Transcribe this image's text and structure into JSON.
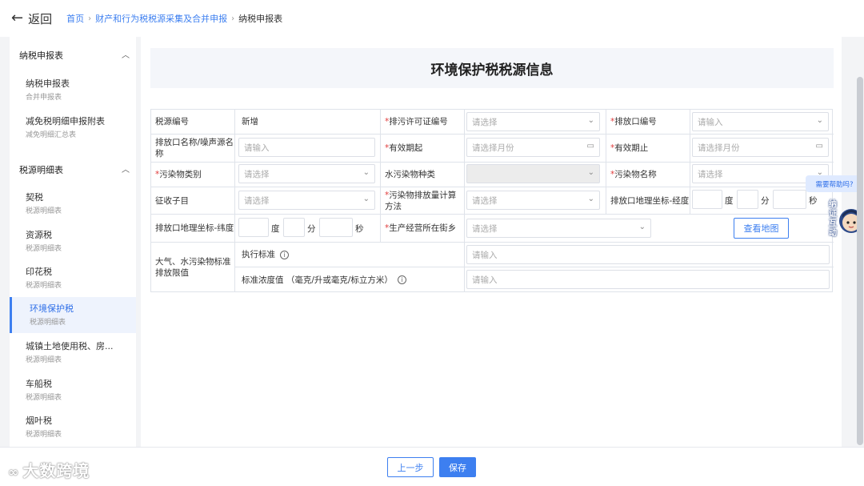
{
  "topbar": {
    "back_label": "返回",
    "breadcrumbs": [
      "首页",
      "财产和行为税税源采集及合并申报",
      "纳税申报表"
    ]
  },
  "sidebar": {
    "groups": [
      {
        "label": "纳税申报表"
      },
      {
        "label": "税源明细表"
      }
    ],
    "items": [
      {
        "label": "纳税申报表",
        "sub": "合并申报表"
      },
      {
        "label": "减免税明细申报附表",
        "sub": "减免明细汇总表"
      },
      {
        "label": "契税",
        "sub": "税源明细表"
      },
      {
        "label": "资源税",
        "sub": "税源明细表"
      },
      {
        "label": "印花税",
        "sub": "税源明细表"
      },
      {
        "label": "环境保护税",
        "sub": "税源明细表"
      },
      {
        "label": "城镇土地使用税、房...",
        "sub": "税源明细表"
      },
      {
        "label": "车船税",
        "sub": "税源明细表"
      },
      {
        "label": "烟叶税",
        "sub": "税源明细表"
      }
    ]
  },
  "form": {
    "title": "环境保护税税源信息",
    "labels": {
      "source_no": "税源编号",
      "source_no_value": "新增",
      "permit_no": "排污许可证编号",
      "outlet_no": "排放口编号",
      "outlet_name": "排放口名称/噪声源名称",
      "valid_from": "有效期起",
      "valid_to": "有效期止",
      "pollutant_type": "污染物类别",
      "water_kind": "水污染物种类",
      "pollutant_name": "污染物名称",
      "collect_item": "征收子目",
      "calc_method": "污染物排放量计算方法",
      "longitude": "排放口地理坐标-经度",
      "latitude": "排放口地理坐标-纬度",
      "street": "生产经营所在街乡",
      "limit_group": "大气、水污染物标准排放限值",
      "exec_standard": "执行标准",
      "std_concentration": "标准浓度值 （毫克/升或毫克/标立方米）"
    },
    "placeholders": {
      "select": "请选择",
      "input": "请输入",
      "month": "请选择月份"
    },
    "units": {
      "deg": "度",
      "min": "分",
      "sec": "秒"
    },
    "required_mark": "*",
    "map_button": "查看地图"
  },
  "footer": {
    "prev_label": "上一步",
    "save_label": "保存",
    "watermark": "大数跨境"
  },
  "assistant": {
    "bubble": "需要帮助吗?",
    "badge": "纳证互动"
  },
  "colors": {
    "accent": "#3d7ff0",
    "required": "#e03b3b"
  }
}
